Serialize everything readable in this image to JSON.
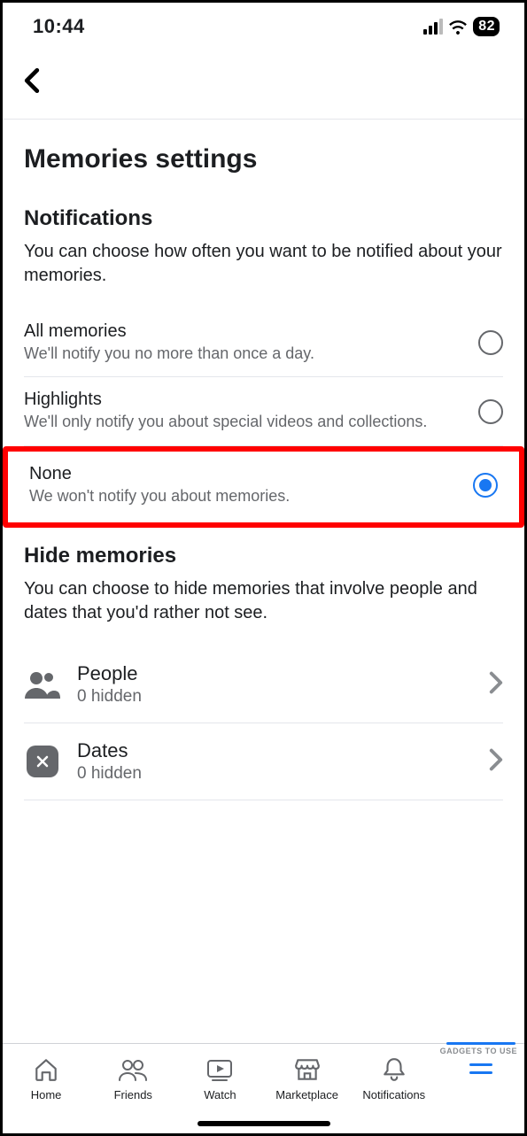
{
  "status": {
    "time": "10:44",
    "battery": "82"
  },
  "page": {
    "title": "Memories settings"
  },
  "notifications": {
    "heading": "Notifications",
    "desc": "You can choose how often you want to be notified about your memories.",
    "options": [
      {
        "title": "All memories",
        "sub": "We'll notify you no more than once a day.",
        "selected": false
      },
      {
        "title": "Highlights",
        "sub": "We'll only notify you about special videos and collections.",
        "selected": false
      },
      {
        "title": "None",
        "sub": "We won't notify you about memories.",
        "selected": true
      }
    ]
  },
  "hide": {
    "heading": "Hide memories",
    "desc": "You can choose to hide memories that involve people and dates that you'd rather not see.",
    "items": [
      {
        "title": "People",
        "sub": "0 hidden"
      },
      {
        "title": "Dates",
        "sub": "0 hidden"
      }
    ]
  },
  "tabs": {
    "home": "Home",
    "friends": "Friends",
    "watch": "Watch",
    "marketplace": "Marketplace",
    "notifications": "Notifications"
  },
  "watermark": "GADGETS TO USE"
}
